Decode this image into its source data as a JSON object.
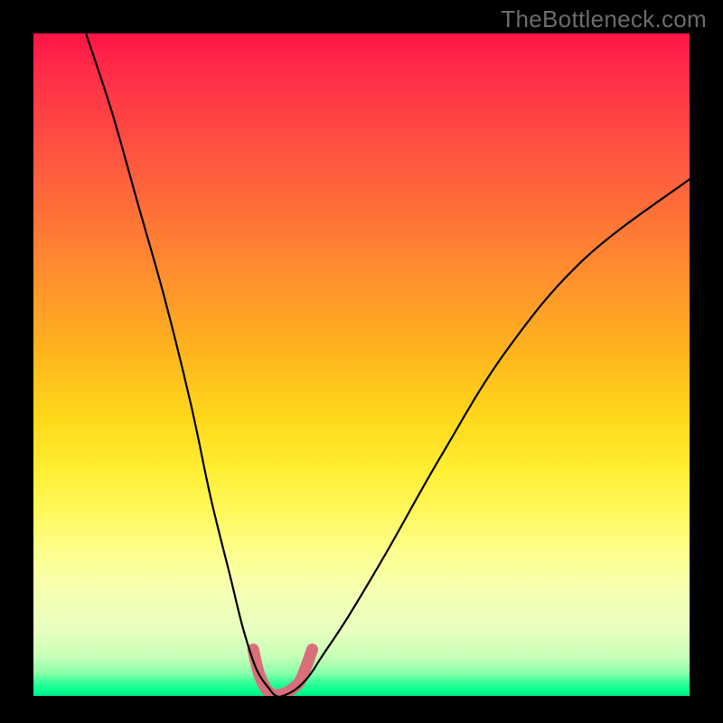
{
  "watermark": "TheBottleneck.com",
  "chart_data": {
    "type": "line",
    "title": "",
    "xlabel": "",
    "ylabel": "",
    "xlim": [
      0,
      100
    ],
    "ylim": [
      0,
      100
    ],
    "grid": false,
    "legend": false,
    "annotations": [],
    "series": [
      {
        "name": "curve",
        "x": [
          8,
          12,
          16,
          20,
          24,
          27,
          30,
          32,
          34,
          36,
          37,
          38,
          40,
          42,
          44,
          48,
          54,
          62,
          72,
          84,
          100
        ],
        "y": [
          100,
          88,
          74,
          60,
          44,
          30,
          18,
          10,
          4,
          1,
          0,
          0,
          1,
          3,
          6,
          12,
          22,
          36,
          52,
          66,
          78
        ]
      },
      {
        "name": "highlight-band",
        "x": [
          33.5,
          34.5,
          36,
          38,
          40,
          41,
          42.5
        ],
        "y": [
          7,
          3,
          0.5,
          0.3,
          1.5,
          3,
          7
        ]
      }
    ],
    "background_gradient": {
      "orientation": "vertical",
      "stops": [
        {
          "pos": 0.0,
          "color": "#ff1446"
        },
        {
          "pos": 0.35,
          "color": "#ff8a30"
        },
        {
          "pos": 0.58,
          "color": "#ffd81a"
        },
        {
          "pos": 0.78,
          "color": "#fdff8a"
        },
        {
          "pos": 0.94,
          "color": "#c8ffb8"
        },
        {
          "pos": 1.0,
          "color": "#00e885"
        }
      ]
    }
  }
}
